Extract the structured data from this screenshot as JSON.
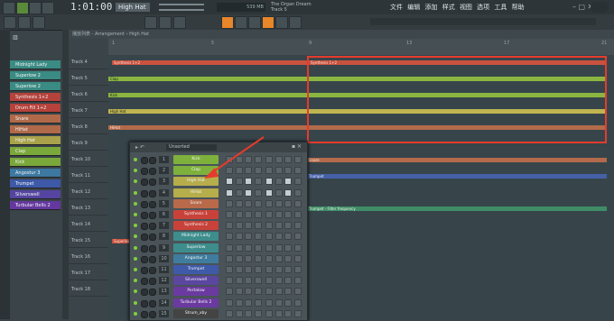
{
  "topbar": {
    "time": "1:01:00",
    "pattern": "High Hat",
    "song_title": "The Organ Dream",
    "track_label": "Track 5",
    "cpu": "539 MB",
    "menu": [
      "文件",
      "编辑",
      "添加",
      "样式",
      "视图",
      "选项",
      "工具",
      "帮助"
    ]
  },
  "playlist": {
    "header": "播放列表 - Arrangement › High Hat",
    "ruler": [
      "1",
      "5",
      "9",
      "13",
      "17",
      "21"
    ],
    "tracks": [
      "Track 4",
      "Track 5",
      "Track 6",
      "Track 7",
      "Track 8",
      "Track 9",
      "Track 10",
      "Track 11",
      "Track 12",
      "Track 13",
      "Track 14",
      "Track 15",
      "Track 16",
      "Track 17",
      "Track 18"
    ],
    "clips": {
      "synth": "Synthesis 1+2",
      "clap": "Clap",
      "kick": "Kick",
      "hihat": "High Hat",
      "hihat2": "HiHat",
      "snare": "Snare",
      "trumpet": "Trumpet",
      "filter": "Trumpet - Filter frequency",
      "superlow": "Superlow"
    }
  },
  "channels": [
    "Midnight Lady",
    "Superlow 2",
    "Superlow 2",
    "Synthesis 1+2",
    "Drum Fill 1+2",
    "Snare",
    "HiHat",
    "High Hat",
    "Clap",
    "Kick",
    "Angostur 3",
    "Trumpet",
    "Silverswell",
    "Turbular Bells 2"
  ],
  "rack": {
    "selector": "Unsorted",
    "rows": [
      {
        "num": "1",
        "name": "Kick",
        "color": "#7eb13c"
      },
      {
        "num": "2",
        "name": "Clap",
        "color": "#7eb13c"
      },
      {
        "num": "3",
        "name": "High Hat",
        "color": "#b6ad4b"
      },
      {
        "num": "4",
        "name": "HiHat",
        "color": "#b6ad4b"
      },
      {
        "num": "5",
        "name": "Snare",
        "color": "#b86a4a"
      },
      {
        "num": "6",
        "name": "Synthesis 1",
        "color": "#c9423a"
      },
      {
        "num": "7",
        "name": "Synthesis 2",
        "color": "#c9423a"
      },
      {
        "num": "8",
        "name": "Midnight Lady",
        "color": "#3e8d8d"
      },
      {
        "num": "9",
        "name": "Superlow",
        "color": "#3e8d8d"
      },
      {
        "num": "10",
        "name": "Angostur 3",
        "color": "#3f7c9e"
      },
      {
        "num": "11",
        "name": "Trumpet",
        "color": "#3f5aa8"
      },
      {
        "num": "12",
        "name": "Silverswell",
        "color": "#5b46a0"
      },
      {
        "num": "13",
        "name": "Portalow",
        "color": "#6a3aa0"
      },
      {
        "num": "14",
        "name": "Turbular Bells 2",
        "color": "#6a3aa0"
      },
      {
        "num": "15",
        "name": "Strum_xby",
        "color": "#444"
      }
    ]
  },
  "colors": {
    "highlight": "#e63b2c",
    "accent": "#e8862a"
  }
}
